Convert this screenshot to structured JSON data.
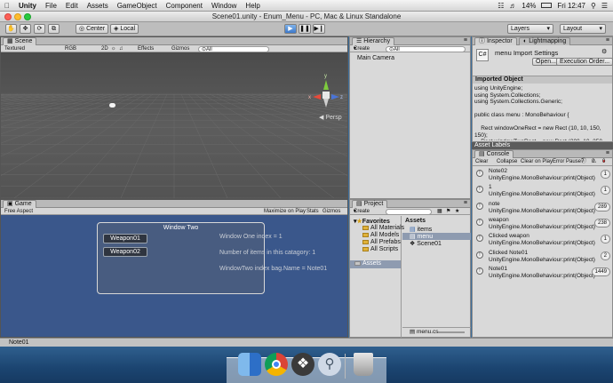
{
  "menubar": {
    "app": "Unity",
    "items": [
      "File",
      "Edit",
      "Assets",
      "GameObject",
      "Component",
      "Window",
      "Help"
    ],
    "battery": "14%",
    "clock": "Fri 12:47"
  },
  "window": {
    "title": "Scene01.unity - Enum_Menu - PC, Mac & Linux Standalone"
  },
  "toolbar": {
    "center_label": "Center",
    "local_label": "Local",
    "layers_label": "Layers",
    "layout_label": "Layout"
  },
  "scene": {
    "tab": "Scene",
    "shading": "Textured",
    "rgb": "RGB",
    "mode2d": "2D",
    "effects": "Effects",
    "gizmos": "Gizmos",
    "search": "⊙All",
    "persp": "Persp",
    "axis_x": "x",
    "axis_y": "y",
    "axis_z": "z"
  },
  "game": {
    "tab": "Game",
    "aspect": "Free Aspect",
    "maximize": "Maximize on Play",
    "stats": "Stats",
    "gizmos": "Gizmos",
    "window_title": "Window Two",
    "btn1": "Weapon01",
    "btn2": "Weapon02",
    "label1": "Window One index = 1",
    "label2": "Number of items in this catagory: 1",
    "label3": "WindowTwo index bag.Name = Note01"
  },
  "hierarchy": {
    "tab": "Hierarchy",
    "create": "Create",
    "search": "⊙All",
    "items": [
      "Main Camera"
    ]
  },
  "project": {
    "tab": "Project",
    "create": "Create",
    "favorites_label": "Favorites",
    "favorites": [
      "All Materials",
      "All Models",
      "All Prefabs",
      "All Scripts"
    ],
    "assets_root": "Assets",
    "assets_header": "Assets",
    "assets": [
      "items",
      "menu",
      "Scene01"
    ],
    "selected_file": "menu.cs"
  },
  "inspector": {
    "tab": "Inspector",
    "tab2": "Lightmapping",
    "title": "menu Import Settings",
    "open_btn": "Open...",
    "exec_btn": "Execution Order...",
    "imported_label": "Imported Object",
    "code": "using UnityEngine;\nusing System.Collections;\nusing System.Collections.Generic;\n\npublic class menu : MonoBehaviour {\n\n    Rect windowOneRect = new Rect (10, 10, 150,\n150);\n    Rect windowTwoRect = new Rect (200, 10, 350,"
  },
  "asset_labels": "Asset Labels",
  "console": {
    "tab": "Console",
    "clear": "Clear",
    "collapse": "Collapse",
    "clear_on_play": "Clear on Play",
    "error_pause": "Error Pause",
    "count_info": "7",
    "count_warn": "0",
    "count_err": "0",
    "rows": [
      {
        "l1": "Note02",
        "l2": "UnityEngine.MonoBehaviour:print(Object)",
        "count": "1"
      },
      {
        "l1": "1",
        "l2": "UnityEngine.MonoBehaviour:print(Object)",
        "count": "1"
      },
      {
        "l1": "note",
        "l2": "UnityEngine.MonoBehaviour:print(Object)",
        "count": "289"
      },
      {
        "l1": "weapon",
        "l2": "UnityEngine.MonoBehaviour:print(Object)",
        "count": "238"
      },
      {
        "l1": "Clicked weapon",
        "l2": "UnityEngine.MonoBehaviour:print(Object)",
        "count": "1"
      },
      {
        "l1": "Clicked Note01",
        "l2": "UnityEngine.MonoBehaviour:print(Object)",
        "count": "2"
      },
      {
        "l1": "Note01",
        "l2": "UnityEngine.MonoBehaviour:print(Object)",
        "count": "1449"
      }
    ]
  },
  "status": "Note01",
  "dock": [
    "finder-icon",
    "chrome-icon",
    "unity-icon",
    "preview-icon",
    "trash-icon"
  ]
}
